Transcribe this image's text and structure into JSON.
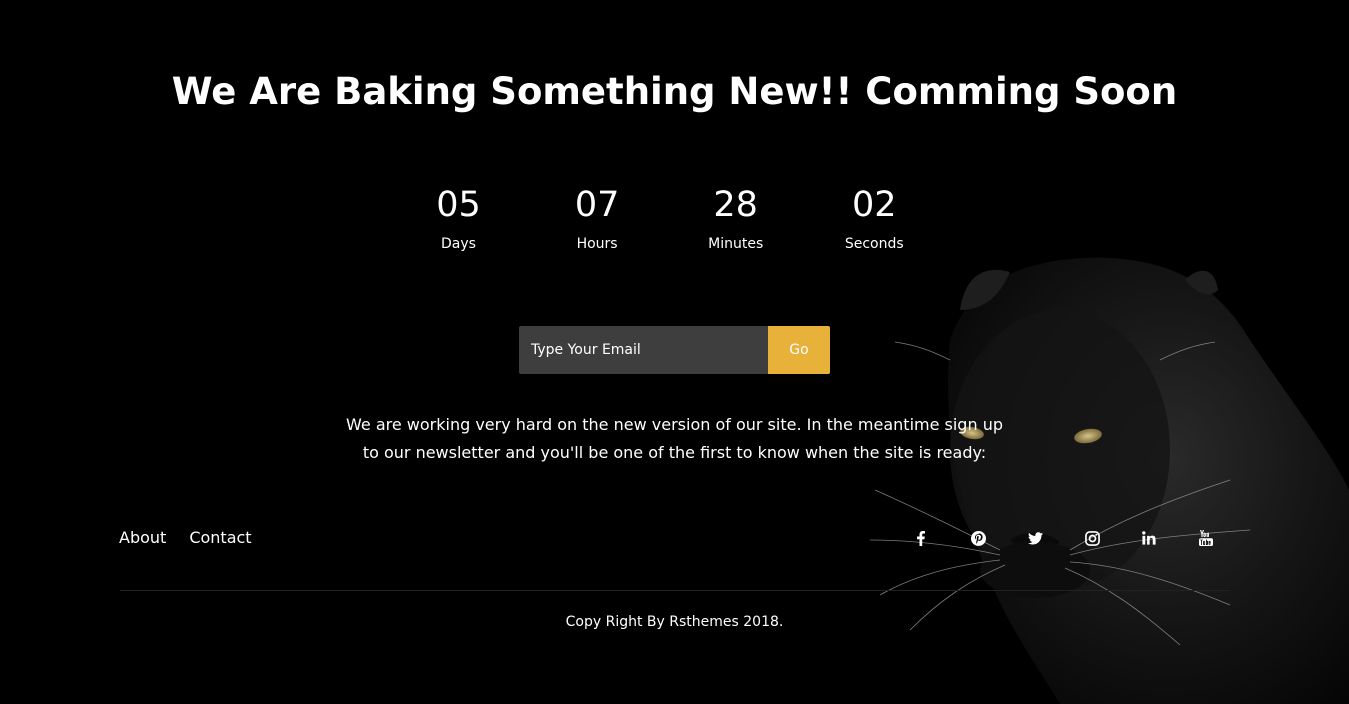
{
  "page": {
    "title": "We Are Baking Something New!! Comming Soon"
  },
  "countdown": [
    {
      "value": "05",
      "label": "Days"
    },
    {
      "value": "07",
      "label": "Hours"
    },
    {
      "value": "28",
      "label": "Minutes"
    },
    {
      "value": "02",
      "label": "Seconds"
    }
  ],
  "subscribe": {
    "placeholder": "Type Your Email",
    "button_label": "Go"
  },
  "description": "We are working very hard on the new version of our site. In the meantime sign up to our newsletter and you'll be one of the first to know when the site is ready:",
  "footer": {
    "links": [
      {
        "label": "About"
      },
      {
        "label": "Contact"
      }
    ],
    "social": [
      {
        "icon": "facebook-icon"
      },
      {
        "icon": "pinterest-icon"
      },
      {
        "icon": "twitter-icon"
      },
      {
        "icon": "instagram-icon"
      },
      {
        "icon": "linkedin-icon"
      },
      {
        "icon": "youtube-icon"
      }
    ],
    "copyright": "Copy Right By Rsthemes 2018."
  },
  "colors": {
    "background": "#000000",
    "accent": "#e8b23a",
    "input_background": "#3e3e3e",
    "text": "#ffffff"
  }
}
